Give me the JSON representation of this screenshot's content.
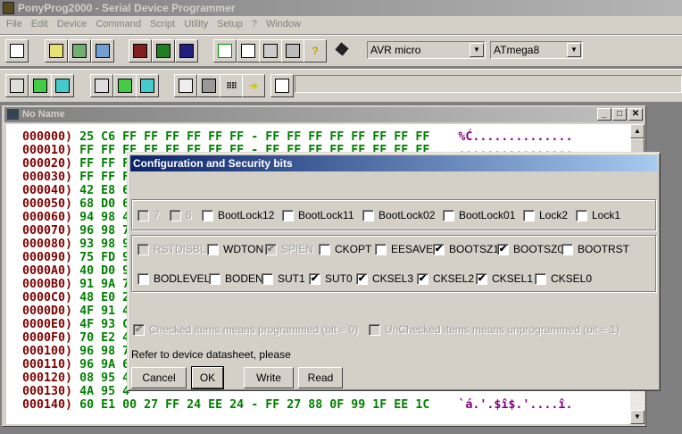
{
  "window": {
    "title": "PonyProg2000 - Serial Device Programmer"
  },
  "menu": [
    "File",
    "Edit",
    "Device",
    "Command",
    "Script",
    "Utility",
    "Setup",
    "?",
    "Window"
  ],
  "toolbar1": {
    "device_family": "AVR micro",
    "device_model": "ATmega8"
  },
  "child": {
    "title": "No Name"
  },
  "hex_rows": [
    {
      "addr": "000000)",
      "hex": "25 C6 FF FF FF FF FF FF - FF FF FF FF FF FF FF FF",
      "ascii": "%Ć.............."
    },
    {
      "addr": "000010)",
      "hex": "FF FF FF FF FF FF FF FF - FF FF FF FF FF FF FF FF",
      "ascii": "................"
    },
    {
      "addr": "000020)",
      "hex": "FF FF F",
      "ascii": ""
    },
    {
      "addr": "000030)",
      "hex": "FF FF F",
      "ascii": ""
    },
    {
      "addr": "000040)",
      "hex": "42 E8 6",
      "ascii": ""
    },
    {
      "addr": "000050)",
      "hex": "68 D0 6",
      "ascii": ""
    },
    {
      "addr": "000060)",
      "hex": "94 98 4",
      "ascii": ""
    },
    {
      "addr": "000070)",
      "hex": "96 98 7",
      "ascii": ""
    },
    {
      "addr": "000080)",
      "hex": "93 98 9",
      "ascii": ""
    },
    {
      "addr": "000090)",
      "hex": "75 FD 9",
      "ascii": ""
    },
    {
      "addr": "0000A0)",
      "hex": "40 D0 9",
      "ascii": ""
    },
    {
      "addr": "0000B0)",
      "hex": "91 9A 7",
      "ascii": ""
    },
    {
      "addr": "0000C0)",
      "hex": "48 E0 2",
      "ascii": ""
    },
    {
      "addr": "0000D0)",
      "hex": "4F 91 4",
      "ascii": ""
    },
    {
      "addr": "0000E0)",
      "hex": "4F 93 C",
      "ascii": ""
    },
    {
      "addr": "0000F0)",
      "hex": "70 E2 4",
      "ascii": ""
    },
    {
      "addr": "000100)",
      "hex": "96 98 7",
      "ascii": ""
    },
    {
      "addr": "000110)",
      "hex": "96 9A 6",
      "ascii": ""
    },
    {
      "addr": "000120)",
      "hex": "08 95 4",
      "ascii": ""
    },
    {
      "addr": "000130)",
      "hex": "4A 95 4",
      "ascii": ""
    },
    {
      "addr": "000140)",
      "hex": "60 E1 00 27 FF 24 EE 24 - FF 27 88 0F 99 1F EE 1C",
      "ascii": "`á.'.$î$.'....î."
    }
  ],
  "dialog": {
    "title": "Configuration and Security bits",
    "lock_bits": [
      {
        "label": "7",
        "checked": false,
        "disabled": true
      },
      {
        "label": "6",
        "checked": false,
        "disabled": true
      },
      {
        "label": "BootLock12",
        "checked": false,
        "disabled": false
      },
      {
        "label": "BootLock11",
        "checked": false,
        "disabled": false
      },
      {
        "label": "BootLock02",
        "checked": false,
        "disabled": false
      },
      {
        "label": "BootLock01",
        "checked": false,
        "disabled": false
      },
      {
        "label": "Lock2",
        "checked": false,
        "disabled": false
      },
      {
        "label": "Lock1",
        "checked": false,
        "disabled": false
      }
    ],
    "fuse_high": [
      {
        "label": "RSTDISBL",
        "checked": false,
        "disabled": true
      },
      {
        "label": "WDTON",
        "checked": false,
        "disabled": false
      },
      {
        "label": "SPIEN",
        "checked": true,
        "disabled": true
      },
      {
        "label": "CKOPT",
        "checked": false,
        "disabled": false
      },
      {
        "label": "EESAVE",
        "checked": false,
        "disabled": false
      },
      {
        "label": "BOOTSZ1",
        "checked": true,
        "disabled": false
      },
      {
        "label": "BOOTSZ0",
        "checked": true,
        "disabled": false
      },
      {
        "label": "BOOTRST",
        "checked": false,
        "disabled": false
      }
    ],
    "fuse_low": [
      {
        "label": "BODLEVEL",
        "checked": false,
        "disabled": false
      },
      {
        "label": "BODEN",
        "checked": false,
        "disabled": false
      },
      {
        "label": "SUT1",
        "checked": false,
        "disabled": false
      },
      {
        "label": "SUT0",
        "checked": true,
        "disabled": false
      },
      {
        "label": "CKSEL3",
        "checked": true,
        "disabled": false
      },
      {
        "label": "CKSEL2",
        "checked": true,
        "disabled": false
      },
      {
        "label": "CKSEL1",
        "checked": true,
        "disabled": false
      },
      {
        "label": "CKSEL0",
        "checked": false,
        "disabled": false
      }
    ],
    "legend_checked": "Checked items means programmed (bit = 0)",
    "legend_unchecked": "UnChecked items means unprogrammed (bit = 1)",
    "note": "Refer to device datasheet, please",
    "buttons": {
      "cancel": "Cancel",
      "ok": "OK",
      "write": "Write",
      "read": "Read"
    }
  }
}
